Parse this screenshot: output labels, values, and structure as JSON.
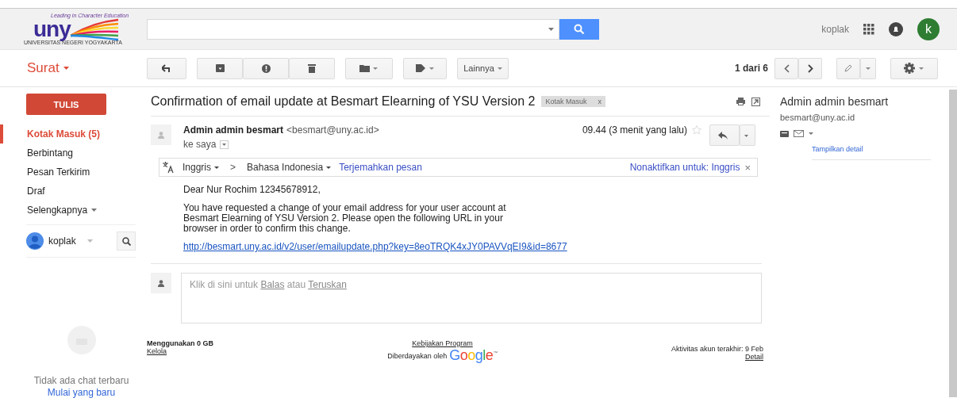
{
  "header": {
    "logo": {
      "letters": "uny",
      "tagline": "Leading in Character Education",
      "institution": "UNIVERSITAS NEGERI YOGYAKARTA"
    },
    "account_name": "koplak",
    "avatar_letter": "k"
  },
  "toolbar": {
    "app_menu": "Surat",
    "more_button": "Lainnya",
    "pager": "1 dari 6"
  },
  "sidebar": {
    "compose": "TULIS",
    "items": [
      {
        "kind": "folder",
        "label": "Kotak Masuk (5)",
        "selected": true
      },
      {
        "kind": "folder",
        "label": "Berbintang",
        "selected": false
      },
      {
        "kind": "folder",
        "label": "Pesan Terkirim",
        "selected": false
      },
      {
        "kind": "folder",
        "label": "Draf",
        "selected": false
      },
      {
        "kind": "more",
        "label": "Selengkapnya",
        "selected": false
      }
    ],
    "chat": {
      "user": "koplak",
      "empty_text": "Tidak ada chat terbaru",
      "start_link": "Mulai yang baru"
    }
  },
  "message": {
    "subject": "Confirmation of email update at Besmart Elearning of YSU Version 2",
    "label": "Kotak Masuk",
    "label_remove": "x",
    "sender_name": "Admin admin besmart",
    "sender_email": "<besmart@uny.ac.id>",
    "time": "09.44 (3 menit yang lalu)",
    "starred": false,
    "recipient": "ke saya",
    "translation": {
      "from": "Inggris",
      "arrow": ">",
      "to": "Bahasa Indonesia",
      "translate_link": "Terjemahkan pesan",
      "disable_link": "Nonaktifkan untuk: Inggris",
      "close": "×"
    },
    "body": [
      {
        "kind": "text",
        "text": "Dear Nur Rochim 12345678912,"
      },
      {
        "kind": "text",
        "text": "You have requested a change of your email address for your user account at Besmart Elearning of YSU Version 2. Please open the following URL in your browser in order to confirm this change."
      },
      {
        "kind": "link",
        "text": "http://besmart.uny.ac.id/v2/user/emailupdate.php?key=8eoTRQK4xJY0PAVVqEI9&id=8677"
      }
    ],
    "reply_box": {
      "prefix": "Klik di sini untuk",
      "reply": "Balas",
      "middle": "atau",
      "forward": "Teruskan"
    }
  },
  "footer": {
    "storage": "Menggunakan 0 GB",
    "manage": "Kelola",
    "policy": "Kebijakan Program",
    "powered_by": "Diberdayakan oleh",
    "brand": "Google",
    "brand_mark": "™",
    "activity": "Aktivitas akun terakhir: 9 Feb",
    "details": "Detail"
  },
  "contact": {
    "name": "Admin admin besmart",
    "email": "besmart@uny.ac.id",
    "details_link": "Tampilkan detail"
  }
}
